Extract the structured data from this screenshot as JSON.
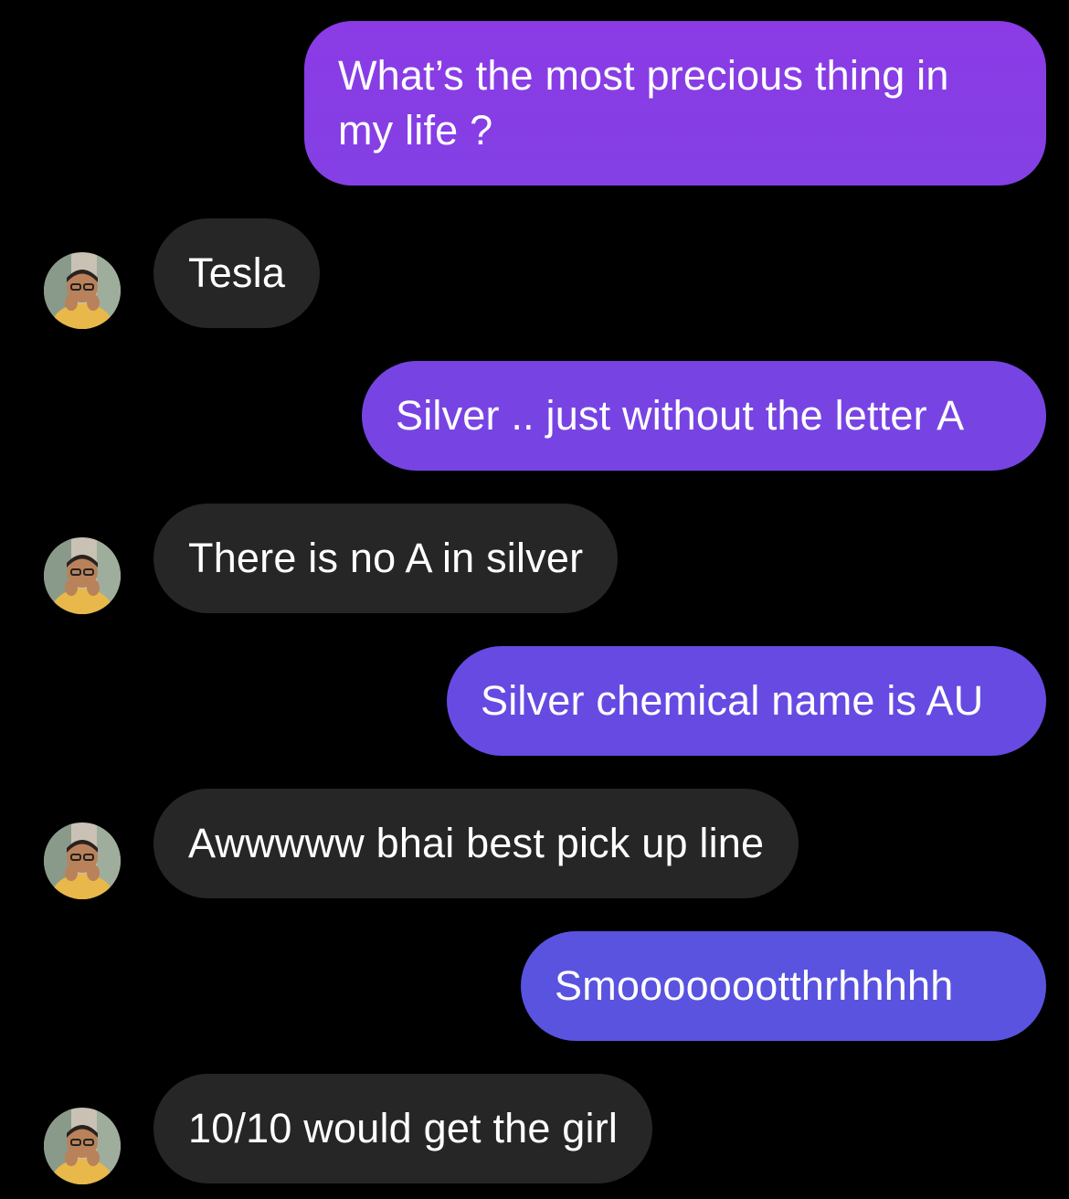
{
  "colors": {
    "background": "#000000",
    "received_bubble": "#262626",
    "sent_gradient": [
      "#8a3ce4",
      "#7a45e3",
      "#6a4de2",
      "#5a55e0"
    ],
    "text": "#ffffff"
  },
  "messages": [
    {
      "sender": "me",
      "text": "What’s the most precious thing in my life ?"
    },
    {
      "sender": "them",
      "text": "Tesla",
      "avatar": "profile-photo"
    },
    {
      "sender": "me",
      "text": "Silver .. just without the letter A"
    },
    {
      "sender": "them",
      "text": "There is no A in silver",
      "avatar": "profile-photo"
    },
    {
      "sender": "me",
      "text": "Silver chemical name is AU"
    },
    {
      "sender": "them",
      "text": "Awwwww bhai best pick up line",
      "avatar": "profile-photo"
    },
    {
      "sender": "me",
      "text": "Smoooooootthrhhhhh"
    },
    {
      "sender": "them",
      "text": "10/10 would get the girl",
      "avatar": "profile-photo"
    }
  ]
}
